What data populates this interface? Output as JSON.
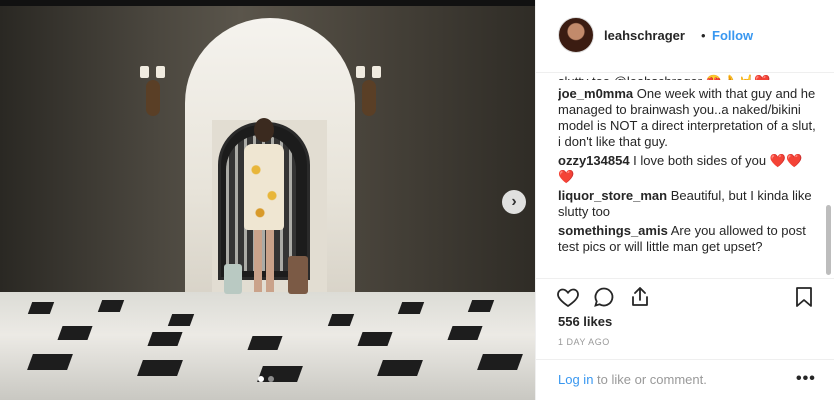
{
  "post": {
    "username": "leahschrager",
    "separator": "•",
    "follow_label": "Follow",
    "likes": "556 likes",
    "time_ago": "1 DAY AGO",
    "login_link": "Log in",
    "login_rest": " to like or comment.",
    "more_label": "•••",
    "next_label": "›"
  },
  "comments": {
    "cut_line": "slutty too @leahschrager 😍👌🤘❤️",
    "items": [
      {
        "user": "joe_m0mma",
        "text": " One week with that guy and he managed to brainwash you..a naked/bikini model is NOT a direct interpretation of a slut, i don't like that guy."
      },
      {
        "user": "ozzy134854",
        "text": " I love both sides of you ❤️❤️❤️"
      },
      {
        "user": "liquor_store_man",
        "text": " Beautiful, but I kinda like slutty too"
      },
      {
        "user": "somethings_amis",
        "text": " Are you allowed to post test pics or will little man get upset?"
      }
    ]
  },
  "icons": {
    "heart": "heart-icon",
    "comment": "comment-icon",
    "share": "share-icon",
    "bookmark": "bookmark-icon"
  },
  "colors": {
    "link": "#3897f0",
    "muted": "#999999",
    "text": "#262626"
  }
}
